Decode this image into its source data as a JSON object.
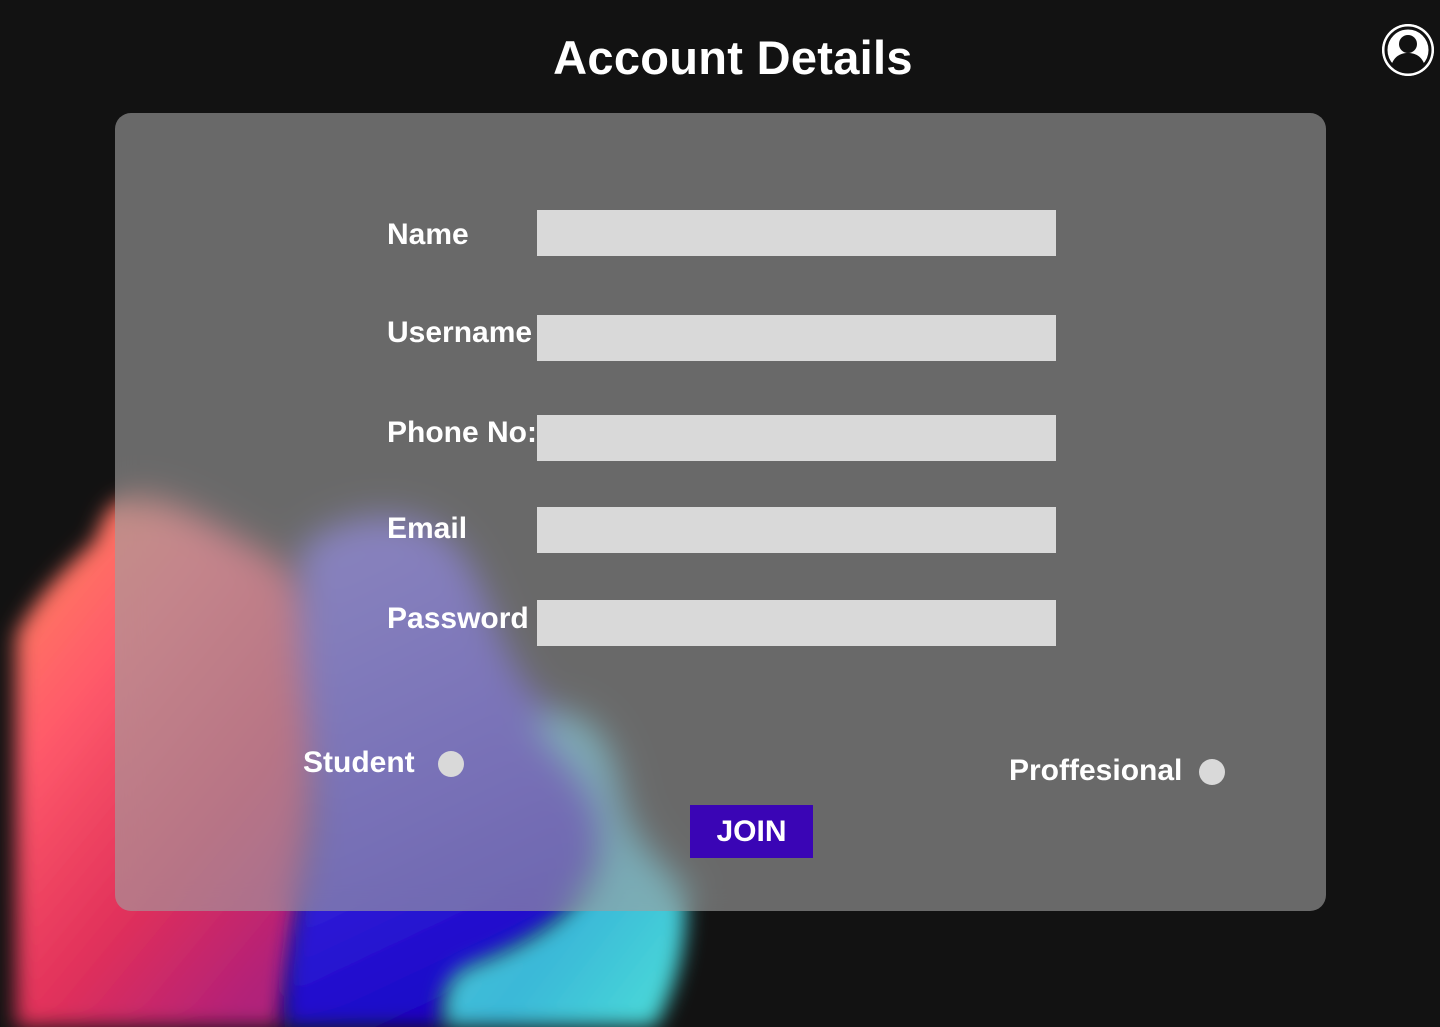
{
  "page": {
    "title": "Account Details"
  },
  "form": {
    "fields": [
      {
        "label": "Name",
        "value": "",
        "placeholder": ""
      },
      {
        "label": "Username",
        "value": "",
        "placeholder": ""
      },
      {
        "label": "Phone No:",
        "value": "",
        "placeholder": ""
      },
      {
        "label": "Email",
        "value": "",
        "placeholder": ""
      },
      {
        "label": "Password",
        "value": "",
        "placeholder": ""
      }
    ],
    "roles": [
      {
        "label": "Student",
        "selected": false
      },
      {
        "label": "Proffesional",
        "selected": false
      }
    ],
    "submit_label": "JOIN"
  },
  "header": {
    "avatar_icon": "user-avatar-icon"
  },
  "colors": {
    "background": "#121212",
    "card": "#8f8f8f",
    "input": "#d9d9d9",
    "button": "#3a05b5",
    "text": "#ffffff"
  }
}
